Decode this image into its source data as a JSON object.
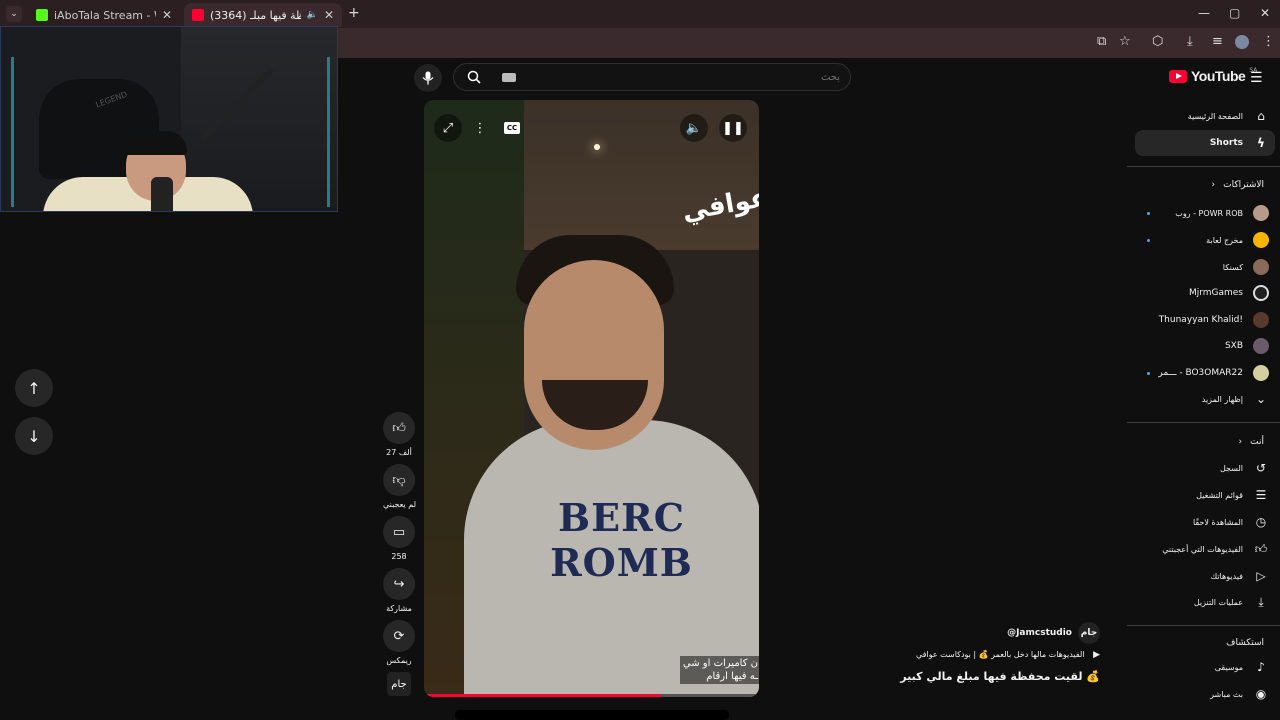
{
  "browser": {
    "tabs": [
      {
        "label": "iAboTala Stream - Watch Live o",
        "favicon_color": "#53fc18"
      },
      {
        "label": "(3364) لقيت محفظة فيها مبلـ",
        "favicon_color": "#ff0033"
      }
    ],
    "new_tab": "+",
    "window_controls": [
      "—",
      "▢",
      "✕"
    ]
  },
  "youtube": {
    "logo_text": "YouTube",
    "logo_sup": "SA",
    "search_placeholder": "بحث",
    "sidebar": {
      "main": [
        {
          "label": "الصفحة الرئيسية",
          "icon": "home-icon"
        },
        {
          "label": "Shorts",
          "icon": "shorts-icon"
        }
      ],
      "subscriptions_title": "الاشتراكات",
      "subscriptions": [
        {
          "label": "روب - POWR ROB",
          "avatar_color": "#b89a8a",
          "dot": true
        },
        {
          "label": "مخرج لعابة",
          "avatar_color": "#f5b400",
          "dot": true
        },
        {
          "label": "كسنكا",
          "avatar_color": "#8a6a5a",
          "dot": false
        },
        {
          "label": "MjrmGames",
          "avatar_color": "#1e1e1e",
          "dot": false
        },
        {
          "label": "Thunayyan Khalid!",
          "avatar_color": "#5a3a2a",
          "dot": false
        },
        {
          "label": "SXB",
          "avatar_color": "#6a5a6a",
          "dot": false
        },
        {
          "label": "ـــمر - BO3OMAR22",
          "avatar_color": "#d4cfa0",
          "dot": true
        }
      ],
      "show_more": "إظهار المزيد",
      "you_title": "أنت",
      "you": [
        {
          "label": "السجل",
          "icon": "history-icon"
        },
        {
          "label": "قوائم التشغيل",
          "icon": "playlists-icon"
        },
        {
          "label": "المشاهدة لاحقًا",
          "icon": "watch-later-icon"
        },
        {
          "label": "الفيديوهات التي أعجبتني",
          "icon": "liked-videos-icon"
        },
        {
          "label": "فيديوهاتك",
          "icon": "your-videos-icon"
        },
        {
          "label": "عمليات التنزيل",
          "icon": "downloads-icon"
        }
      ],
      "explore_title": "استكشاف",
      "explore": [
        {
          "label": "موسيقى",
          "icon": "music-icon"
        },
        {
          "label": "بث مباشر",
          "icon": "live-icon"
        }
      ]
    },
    "short": {
      "overlay_logo": "عوافي",
      "chest_text": "BERC ROMB",
      "caption_line1": "ن كاميرات او شي",
      "caption_line2": "ـه فيها ارقام",
      "progress": 0.71,
      "actions": {
        "likes": "27 ألف",
        "dislike": "لم يعجبني",
        "comments": "258",
        "share": "مشاركة",
        "remix": "ريمكس"
      },
      "channel_mark": "جام",
      "handle": "@Jamcstudio",
      "playlist": "الفيديوهات مالها دخل بالعمر 💰 | بودكاست عوافي",
      "title": "لقيت محفظة فيها مبلغ مالي كبير 💰"
    }
  },
  "webcam": {
    "chair_brand": "LEGEND"
  }
}
